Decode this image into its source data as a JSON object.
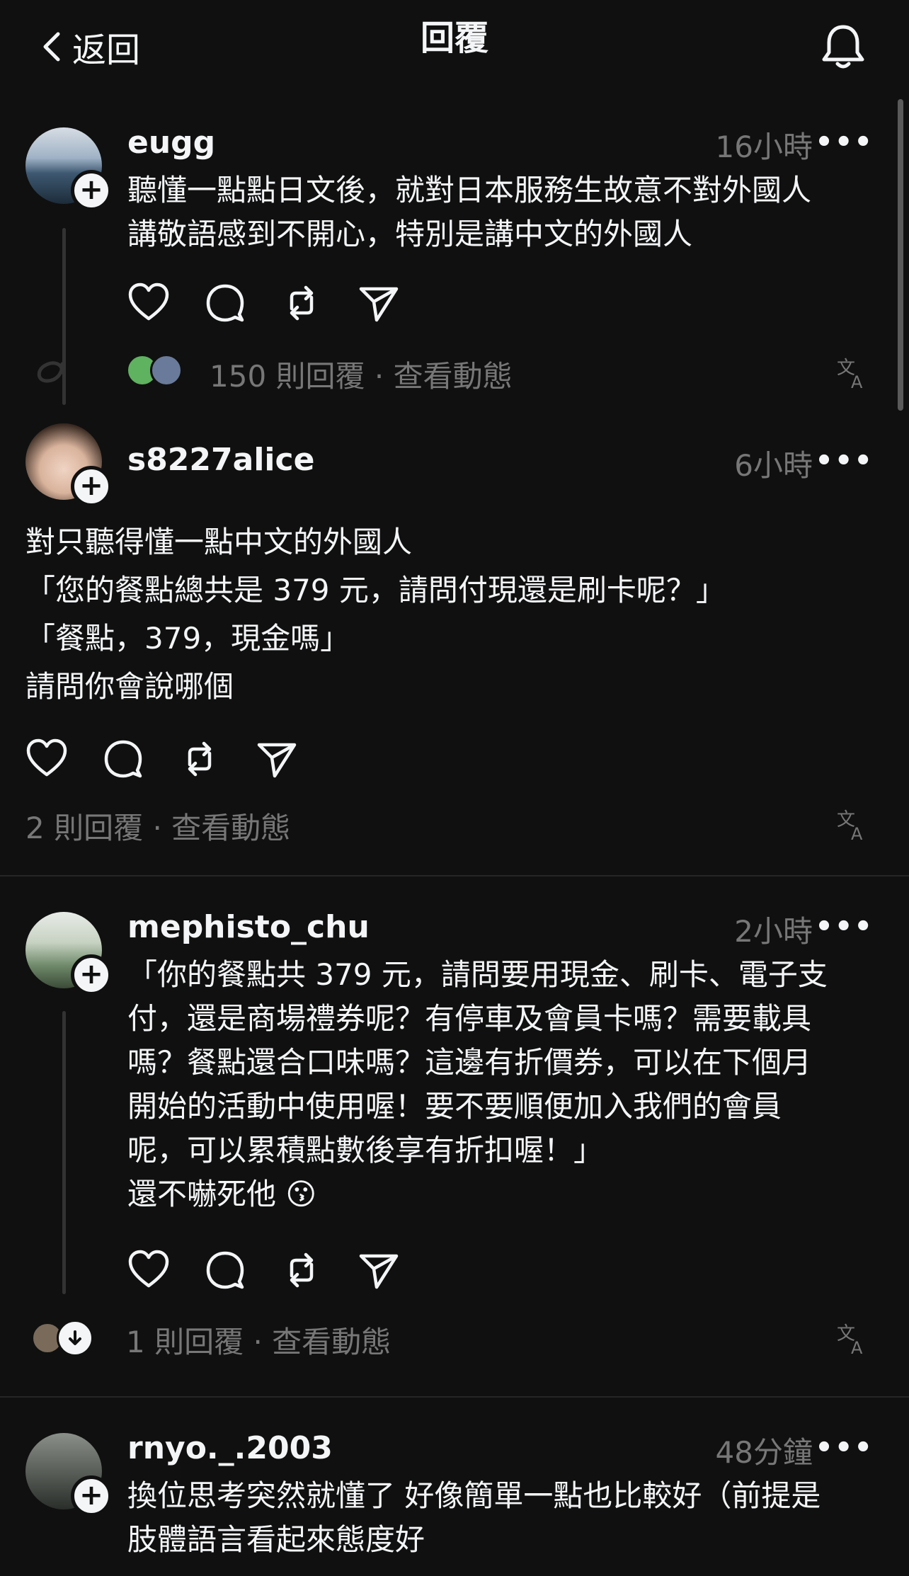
{
  "header": {
    "back_label": "返回",
    "title": "回覆"
  },
  "posts": [
    {
      "username": "eugg",
      "time": "16小時",
      "text": "聽懂一點點日文後，就對日本服務生故意不對外國人\n講敬語感到不開心，特別是講中文的外國人",
      "replies": "150 則回覆",
      "activity": "查看動態"
    },
    {
      "username": "s8227alice",
      "time": "6小時",
      "text": "對只聽得懂一點中文的外國人\n「您的餐點總共是 379 元，請問付現還是刷卡呢？」\n「餐點，379，現金嗎」\n請問你會說哪個",
      "replies": "2 則回覆",
      "activity": "查看動態"
    },
    {
      "username": "mephisto_chu",
      "time": "2小時",
      "text": "「你的餐點共 379 元，請問要用現金、刷卡、電子支\n付，還是商場禮券呢？有停車及會員卡嗎？需要載具\n嗎？餐點還合口味嗎？這邊有折價券，可以在下個月\n開始的活動中使用喔！要不要順便加入我們的會員\n呢，可以累積點數後享有折扣喔！」\n還不嚇死他 😗",
      "replies": "1 則回覆",
      "activity": "查看動態"
    },
    {
      "username": "rnyo._.2003",
      "time": "48分鐘",
      "text": "換位思考突然就懂了 好像簡單一點也比較好（前提是\n肢體語言看起來態度好"
    }
  ],
  "separator": "·",
  "more_label": "•••",
  "plus_label": "+",
  "colors": {
    "background": "#101010",
    "text": "#f3f5f7",
    "muted": "#777777"
  }
}
